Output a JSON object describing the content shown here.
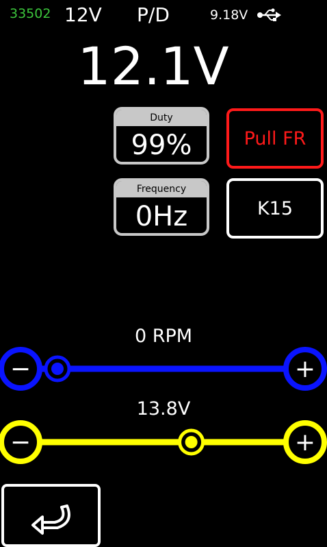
{
  "status": {
    "counter": "33502",
    "supply": "12V",
    "mode": "P/D",
    "usb_voltage": "9.18V",
    "usb_icon": "usb-icon"
  },
  "main_voltage": "12.1V",
  "duty": {
    "caption": "Duty",
    "value": "99%"
  },
  "frequency": {
    "caption": "Frequency",
    "value": "0Hz"
  },
  "buttons": {
    "pull": "Pull FR",
    "k15": "K15",
    "back_icon": "back-arrow-icon"
  },
  "rpm_slider": {
    "label": "0 RPM",
    "level": 0.0,
    "color": "#0a14ff",
    "minus": "−",
    "plus": "+"
  },
  "voltage_slider": {
    "label": "13.8V",
    "level": 0.6,
    "color": "#ffff00",
    "minus": "−",
    "plus": "+"
  },
  "colors": {
    "counter": "#3cc63c",
    "pull_accent": "#ff1a1a",
    "card_border": "#c8c8c8"
  }
}
